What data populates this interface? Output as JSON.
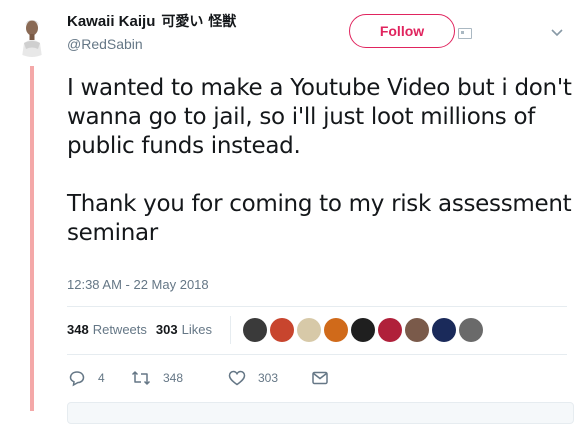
{
  "author": {
    "display_name": "Kawaii Kaiju",
    "display_name_cjk": "可愛い 怪獣",
    "handle": "@RedSabin"
  },
  "follow_label": "Follow",
  "tweet": {
    "paragraph_1": "I wanted to make a Youtube Video but i don't wanna go to jail, so i'll just loot millions of public funds instead.",
    "paragraph_2": "Thank you for coming to my risk assessment seminar",
    "timestamp": "12:38 AM - 22 May 2018"
  },
  "stats": {
    "retweets_count": "348",
    "retweets_label": "Retweets",
    "likes_count": "303",
    "likes_label": "Likes"
  },
  "facepile_colors": [
    "#3a3a3a",
    "#c8452e",
    "#d7c9a8",
    "#d06a1a",
    "#1f1f1f",
    "#b0203a",
    "#7a5a4a",
    "#1a2a5a",
    "#6a6a6a"
  ],
  "actions": {
    "reply_count": "4",
    "retweet_count": "348",
    "like_count": "303"
  },
  "colors": {
    "accent": "#e0245e",
    "thread_line": "#f4a8a8",
    "secondary_text": "#657786"
  }
}
